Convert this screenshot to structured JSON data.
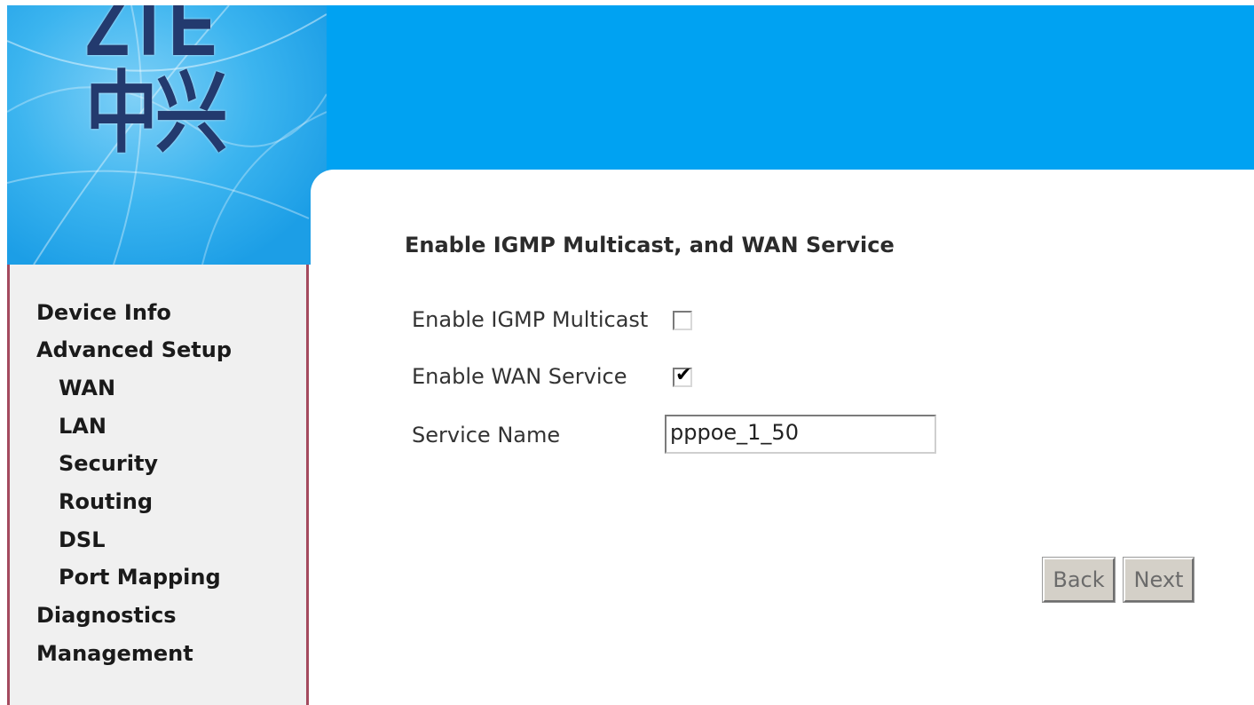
{
  "brand": {
    "logo_text": "ZTE中兴"
  },
  "sidebar": {
    "items": [
      {
        "label": "Device Info"
      },
      {
        "label": "Advanced Setup"
      },
      {
        "label": "WAN"
      },
      {
        "label": "LAN"
      },
      {
        "label": "Security"
      },
      {
        "label": "Routing"
      },
      {
        "label": "DSL"
      },
      {
        "label": "Port Mapping"
      },
      {
        "label": "Diagnostics"
      },
      {
        "label": "Management"
      }
    ]
  },
  "main": {
    "title": "Enable IGMP Multicast, and WAN Service",
    "igmp_label": "Enable IGMP Multicast",
    "igmp_checked": false,
    "wan_label": "Enable WAN Service",
    "wan_checked": true,
    "wan_check_glyph": "✔",
    "service_name_label": "Service Name",
    "service_name_value": "pppoe_1_50"
  },
  "buttons": {
    "back_label": "Back",
    "next_label": "Next"
  },
  "colors": {
    "header_blue": "#00a2f2",
    "logo_navy": "#233a6e",
    "sidebar_bg": "#f0f0f0",
    "sidebar_border": "#a44a5e",
    "button_face": "#d4d0c8"
  }
}
